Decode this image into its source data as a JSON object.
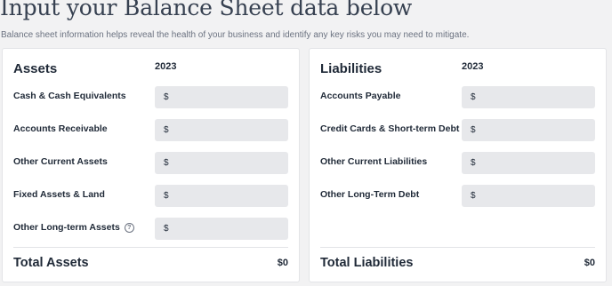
{
  "header": {
    "title": "Input your Balance Sheet data below",
    "subtitle": "Balance sheet information helps reveal the health of your business and identify any key risks you may need to mitigate."
  },
  "assets": {
    "heading": "Assets",
    "year": "2023",
    "rows": [
      {
        "label": "Cash & Cash Equivalents",
        "currency": "$",
        "value": ""
      },
      {
        "label": "Accounts Receivable",
        "currency": "$",
        "value": ""
      },
      {
        "label": "Other Current Assets",
        "currency": "$",
        "value": ""
      },
      {
        "label": "Fixed Assets & Land",
        "currency": "$",
        "value": ""
      },
      {
        "label": "Other Long-term Assets",
        "currency": "$",
        "value": ""
      }
    ],
    "help_icon": "?",
    "total_label": "Total Assets",
    "total_value": "$0"
  },
  "liabilities": {
    "heading": "Liabilities",
    "year": "2023",
    "rows": [
      {
        "label": "Accounts Payable",
        "currency": "$",
        "value": ""
      },
      {
        "label": "Credit Cards & Short-term Debt",
        "currency": "$",
        "value": ""
      },
      {
        "label": "Other Current Liabilities",
        "currency": "$",
        "value": ""
      },
      {
        "label": "Other Long-Term Debt",
        "currency": "$",
        "value": ""
      }
    ],
    "total_label": "Total Liabilities",
    "total_value": "$0"
  }
}
